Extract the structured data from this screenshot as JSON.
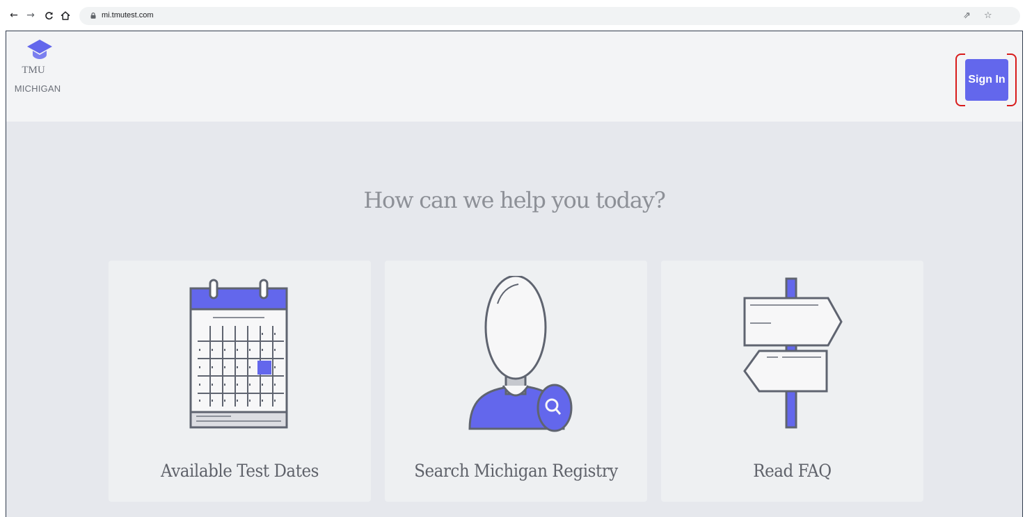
{
  "browser": {
    "url": "mi.tmutest.com",
    "icons": [
      "back-arrow-icon",
      "forward-arrow-icon",
      "reload-icon",
      "home-icon",
      "lock-icon",
      "share-icon",
      "bookmark-star-icon"
    ]
  },
  "header": {
    "logo_line1": "TMU",
    "logo_line2": "MICHIGAN",
    "signin_label": "Sign In"
  },
  "main": {
    "headline": "How can we help you today?",
    "cards": [
      {
        "label": "Available Test Dates",
        "icon": "calendar-icon"
      },
      {
        "label": "Search Michigan Registry",
        "icon": "person-search-icon"
      },
      {
        "label": "Read FAQ",
        "icon": "signpost-icon"
      }
    ]
  },
  "colors": {
    "accent": "#6367ec",
    "highlight_border": "#d81b1b",
    "page_bg": "#e6e8ed",
    "card_bg": "#eef0f2"
  }
}
